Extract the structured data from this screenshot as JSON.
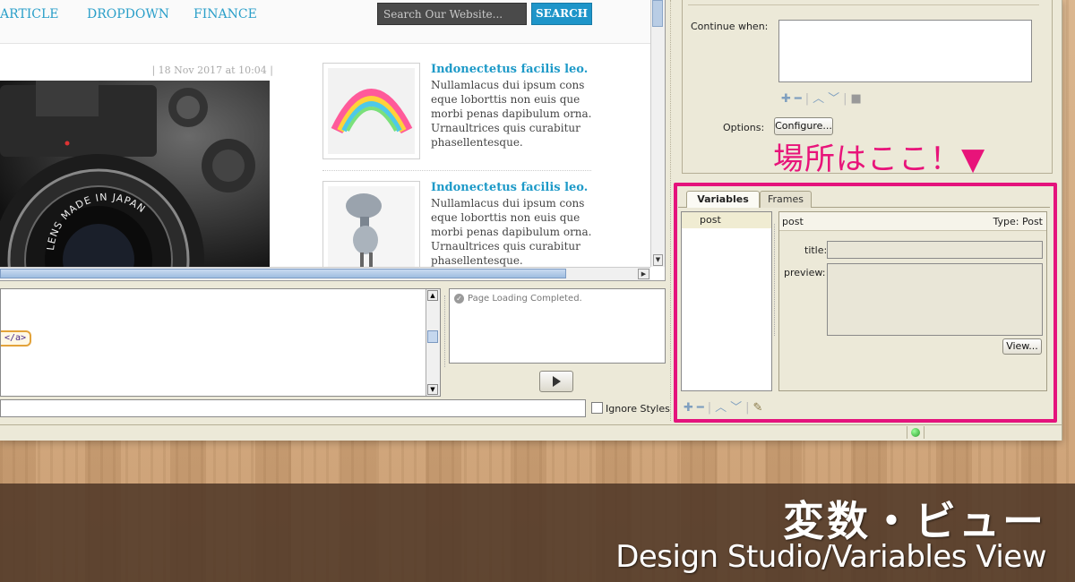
{
  "site": {
    "nav": [
      "ARTICLE",
      "DROPDOWN",
      "FINANCE"
    ],
    "search_placeholder": "Search Our Website...",
    "search_button": "SEARCH",
    "date_meta": "| 18 Nov 2017 at 10:04 |",
    "feature_lens_text": "LENS MADE IN JAPAN",
    "posts": [
      {
        "title": "Indonectetus facilis leo.",
        "body": "Nullamlacus dui ipsum cons eque loborttis non euis que morbi penas dapibulum orna. Urnaultrices quis curabitur phasellentesque."
      },
      {
        "title": "Indonectetus facilis leo.",
        "body": "Nullamlacus dui ipsum cons eque loborttis non euis que morbi penas dapibulum orna. Urnaultrices quis curabitur phasellentesque."
      }
    ]
  },
  "source": {
    "tag_text": "</a>"
  },
  "log": {
    "message": "Page Loading Completed."
  },
  "bottom": {
    "ignore_styles_label": "Ignore Styles"
  },
  "inspector": {
    "continue_when_label": "Continue when:",
    "options_label": "Options:",
    "configure_button": "Configure...",
    "callout": "場所はここ！▼"
  },
  "variables_panel": {
    "tabs": [
      "Variables",
      "Frames"
    ],
    "active_tab": "Variables",
    "items": [
      "post"
    ],
    "detail": {
      "name": "post",
      "type": "Type: Post",
      "fields": [
        "title:",
        "preview:"
      ],
      "view_button": "View..."
    }
  },
  "banner": {
    "title": "変数・ビュー",
    "subtitle": "Design Studio/Variables View"
  },
  "colors": {
    "highlight": "#e4137c",
    "link": "#1e9ac8",
    "banner_bg": "#4e3726"
  }
}
